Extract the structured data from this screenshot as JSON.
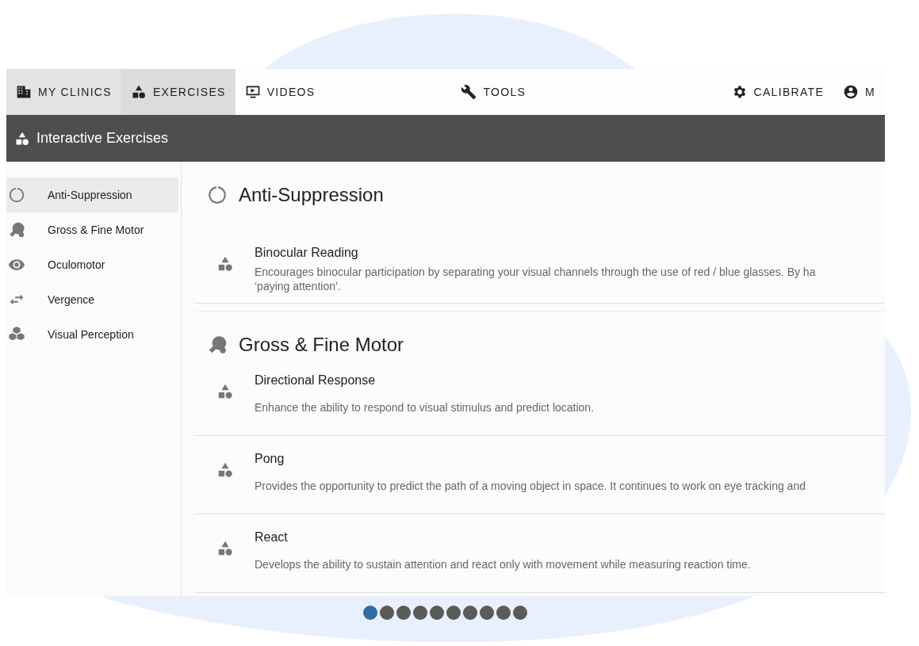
{
  "nav": {
    "items": [
      {
        "label": "MY CLINICS",
        "selected": false,
        "hovered": true
      },
      {
        "label": "EXERCISES",
        "selected": true,
        "hovered": false
      },
      {
        "label": "VIDEOS",
        "selected": false,
        "hovered": false
      },
      {
        "label": "TOOLS",
        "selected": false,
        "hovered": false
      }
    ],
    "right_items": [
      {
        "label": "CALIBRATE"
      },
      {
        "label": "M"
      }
    ]
  },
  "header": {
    "title": "Interactive Exercises"
  },
  "sidebar": {
    "items": [
      {
        "label": "Anti-Suppression",
        "selected": true
      },
      {
        "label": "Gross & Fine Motor",
        "selected": false
      },
      {
        "label": "Oculomotor",
        "selected": false
      },
      {
        "label": "Vergence",
        "selected": false
      },
      {
        "label": "Visual Perception",
        "selected": false
      }
    ]
  },
  "sections": [
    {
      "title": "Anti-Suppression",
      "exercises": [
        {
          "title": "Binocular Reading",
          "description": [
            "Encourages binocular participation by separating your visual channels through the use of red / blue glasses. By ha",
            "‘paying attention’."
          ]
        }
      ]
    },
    {
      "title": "Gross & Fine Motor",
      "exercises": [
        {
          "title": "Directional Response",
          "description": [
            "Enhance the ability to respond to visual stimulus and predict location."
          ]
        },
        {
          "title": "Pong",
          "description": [
            "Provides the opportunity to predict the path of a moving object in space.  It continues to work on eye tracking and"
          ]
        },
        {
          "title": "React",
          "description": [
            "Develops the ability to sustain attention and react only with movement while measuring reaction time."
          ]
        }
      ]
    }
  ],
  "pager": {
    "dots": [
      {
        "selected": true
      },
      {
        "selected": false
      },
      {
        "selected": false
      },
      {
        "selected": false
      },
      {
        "selected": false
      },
      {
        "selected": false
      },
      {
        "selected": false
      },
      {
        "selected": false
      },
      {
        "selected": false
      },
      {
        "selected": false
      }
    ]
  }
}
